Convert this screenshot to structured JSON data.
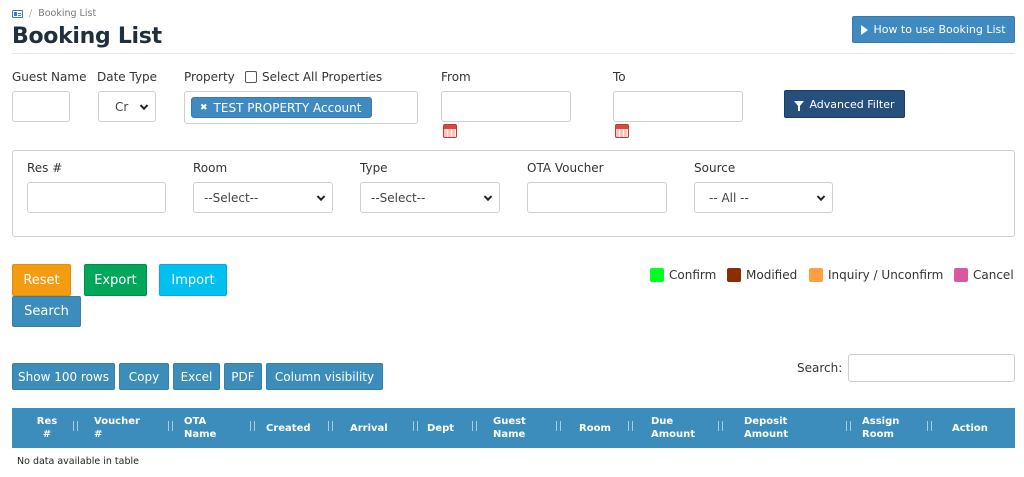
{
  "breadcrumb": {
    "current": "Booking List",
    "separator": "/"
  },
  "header": {
    "title": "Booking List",
    "help_button": "How to use Booking List"
  },
  "filters": {
    "guest_name": {
      "label": "Guest Name",
      "value": ""
    },
    "date_type": {
      "label": "Date Type",
      "value": "Cr"
    },
    "property": {
      "label": "Property",
      "select_all_label": "Select All Properties",
      "select_all_checked": false,
      "selected_tags": [
        "TEST PROPERTY Account"
      ]
    },
    "from": {
      "label": "From",
      "value": ""
    },
    "to": {
      "label": "To",
      "value": ""
    },
    "advanced_button": "Advanced Filter"
  },
  "advanced": {
    "res_no": {
      "label": "Res #",
      "value": ""
    },
    "room": {
      "label": "Room",
      "value": "--Select--"
    },
    "type": {
      "label": "Type",
      "value": "--Select--"
    },
    "ota_voucher": {
      "label": "OTA Voucher",
      "value": ""
    },
    "source": {
      "label": "Source",
      "value": "-- All --"
    }
  },
  "actions": {
    "reset": "Reset",
    "export": "Export",
    "import": "Import",
    "search": "Search"
  },
  "legend": [
    {
      "label": "Confirm",
      "color": "#00ff22"
    },
    {
      "label": "Modified",
      "color": "#8b2e00"
    },
    {
      "label": "Inquiry / Unconfirm",
      "color": "#ffa040"
    },
    {
      "label": "Cancel",
      "color": "#d65a9f"
    }
  ],
  "table_tools": {
    "show_rows": "Show 100 rows",
    "copy": "Copy",
    "excel": "Excel",
    "pdf": "PDF",
    "column_visibility": "Column visibility"
  },
  "search": {
    "label": "Search:",
    "value": ""
  },
  "table": {
    "headers": [
      [
        "Res",
        "#"
      ],
      [
        "Voucher",
        "#"
      ],
      [
        "OTA",
        "Name"
      ],
      [
        "Created"
      ],
      [
        "Arrival"
      ],
      [
        "Dept"
      ],
      [
        "Guest",
        "Name"
      ],
      [
        "Room"
      ],
      [
        "Due",
        "Amount"
      ],
      [
        "Deposit",
        "Amount"
      ],
      [
        "Assign",
        "Room"
      ],
      [
        "Action"
      ]
    ],
    "empty_message": "No data available in table"
  },
  "colors": {
    "primary": "#3c8dbc",
    "dark_button": "#274f7c",
    "reset": "#f39c12",
    "export": "#00a65a",
    "import": "#00c0ef"
  }
}
